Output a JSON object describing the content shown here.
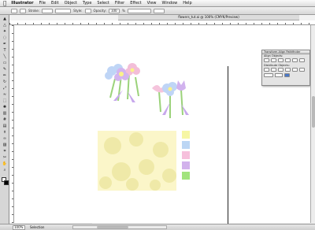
{
  "menubar": {
    "apple_icon": "apple-icon",
    "app_name": "Illustrator",
    "items": [
      "File",
      "Edit",
      "Object",
      "Type",
      "Select",
      "Filter",
      "Effect",
      "View",
      "Window",
      "Help"
    ]
  },
  "control_bar": {
    "stroke_label": "Stroke:",
    "style_label": "Style:",
    "opacity_label": "Opacity:",
    "opacity_value": "100",
    "unit": "%"
  },
  "document": {
    "title": "flowers_tut.ai @ 100% (CMYK/Preview)"
  },
  "tools": {
    "icons": [
      "selection-tool-icon",
      "direct-selection-icon",
      "magic-wand-icon",
      "lasso-icon",
      "pen-tool-icon",
      "type-tool-icon",
      "line-tool-icon",
      "rectangle-tool-icon",
      "paintbrush-icon",
      "pencil-icon",
      "rotate-tool-icon",
      "scale-tool-icon",
      "warp-tool-icon",
      "free-transform-icon",
      "symbol-sprayer-icon",
      "graph-tool-icon",
      "mesh-tool-icon",
      "gradient-tool-icon",
      "eyedropper-icon",
      "blend-tool-icon",
      "live-paint-icon",
      "slice-tool-icon",
      "scissors-icon",
      "hand-tool-icon",
      "zoom-tool-icon"
    ]
  },
  "panel": {
    "title": "Transform  Align  Pathfinder",
    "align_objects_label": "Align Objects:",
    "distribute_objects_label": "Distribute Objects:"
  },
  "artwork": {
    "swatch_colors": [
      "#f6f6a4",
      "#bcd6f4",
      "#f6c0dc",
      "#d2b2ec",
      "#a2e47e"
    ],
    "pattern_bg": "#fbf6c9"
  },
  "status": {
    "zoom": "100%",
    "tool_name": "Selection"
  }
}
